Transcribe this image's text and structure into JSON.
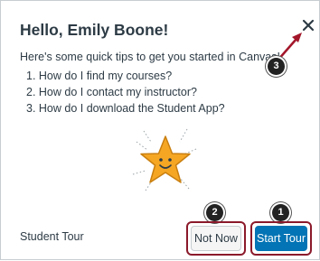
{
  "dialog": {
    "title": "Hello, Emily Boone!",
    "intro": "Here's some quick tips to get you started in Canvas!",
    "tips": [
      "1. How do I find my courses?",
      "2. How do I contact my instructor?",
      "3. How do I download the Student App?"
    ],
    "close_icon": "close-icon",
    "illustration": "smiling-star-icon"
  },
  "footer": {
    "label": "Student Tour",
    "not_now_label": "Not Now",
    "start_tour_label": "Start Tour"
  },
  "callouts": {
    "close": "3",
    "not_now": "2",
    "start_tour": "1"
  },
  "colors": {
    "primary": "#0374b5",
    "highlight": "#8b1a2b",
    "star": "#f5a623",
    "text": "#2d3b45"
  }
}
